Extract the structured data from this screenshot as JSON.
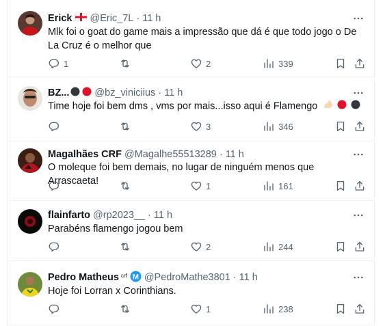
{
  "tweets": [
    {
      "name": "Erick",
      "name_emoji": "england-flag",
      "handle": "@Eric_7L",
      "time": "11 h",
      "text": "Mlk foi o goat do game mais a impressão que dá é que todo jogo o De La Cruz é o melhor que",
      "replies": "1",
      "retweets": "",
      "likes": "2",
      "views": "339"
    },
    {
      "name": "BZ...",
      "name_emoji": "black-circle red-circle",
      "handle": "@bz_viniciius",
      "time": "11 h",
      "text": "Time hoje foi bem dms , vms por mais...isso aqui é Flamengo",
      "text_emoji": "flexed-biceps red-circle black-circle",
      "replies": "",
      "retweets": "",
      "likes": "3",
      "views": "346"
    },
    {
      "name": "Magalhães CRF",
      "handle": "@Magalhe55513289",
      "time": "11 h",
      "text": "O moleque foi bem demais, no lugar de ninguém menos que  Arrascaeta!",
      "replies": "",
      "retweets": "",
      "likes": "1",
      "views": "161"
    },
    {
      "name": "flainfarto",
      "handle": "@rp2023__",
      "time": "11 h",
      "text": "Parabéns flamengo jogou bem",
      "replies": "",
      "retweets": "",
      "likes": "2",
      "views": "244"
    },
    {
      "name": "Pedro Matheus",
      "name_suffix": "crf",
      "name_badge": "M",
      "handle": "@PedroMathe3801",
      "time": "11 h",
      "text": "Hoje foi Lorran x Corinthians.",
      "replies": "",
      "retweets": "",
      "likes": "1",
      "views": "238"
    }
  ],
  "separator": "·",
  "colors": {
    "text": "#0f1419",
    "secondary": "#536471",
    "border": "#eff3f4",
    "flamengo_red": "#e0112b",
    "verified_blue": "#1d9bf0"
  },
  "icons": [
    "reply-icon",
    "retweet-icon",
    "like-icon",
    "views-icon",
    "bookmark-icon",
    "share-icon",
    "more-icon"
  ]
}
